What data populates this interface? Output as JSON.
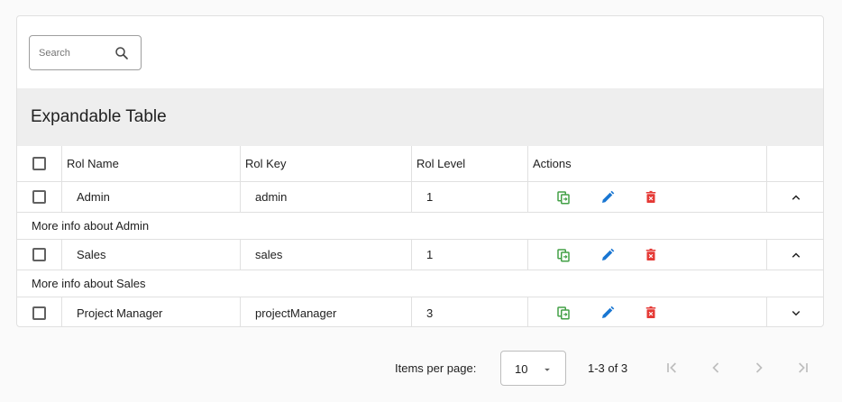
{
  "search": {
    "placeholder": "Search",
    "value": ""
  },
  "table": {
    "title": "Expandable Table",
    "columns": {
      "name": "Rol Name",
      "key": "Rol Key",
      "level": "Rol Level",
      "actions": "Actions"
    },
    "rows": [
      {
        "name": "Admin",
        "key": "admin",
        "level": "1",
        "expanded": true,
        "detail": "More info about Admin"
      },
      {
        "name": "Sales",
        "key": "sales",
        "level": "1",
        "expanded": true,
        "detail": "More info about Sales"
      },
      {
        "name": "Project Manager",
        "key": "projectManager",
        "level": "3",
        "expanded": false,
        "detail": ""
      }
    ],
    "action_icons": [
      "copy-icon",
      "edit-icon",
      "delete-icon"
    ]
  },
  "paginator": {
    "items_per_page_label": "Items per page:",
    "page_size": "10",
    "range_label": "1-3 of 3"
  },
  "colors": {
    "copy": "#43a047",
    "edit": "#1976d2",
    "delete": "#e53935",
    "header_bg": "#eeeeee",
    "border": "#e0e0e0"
  }
}
